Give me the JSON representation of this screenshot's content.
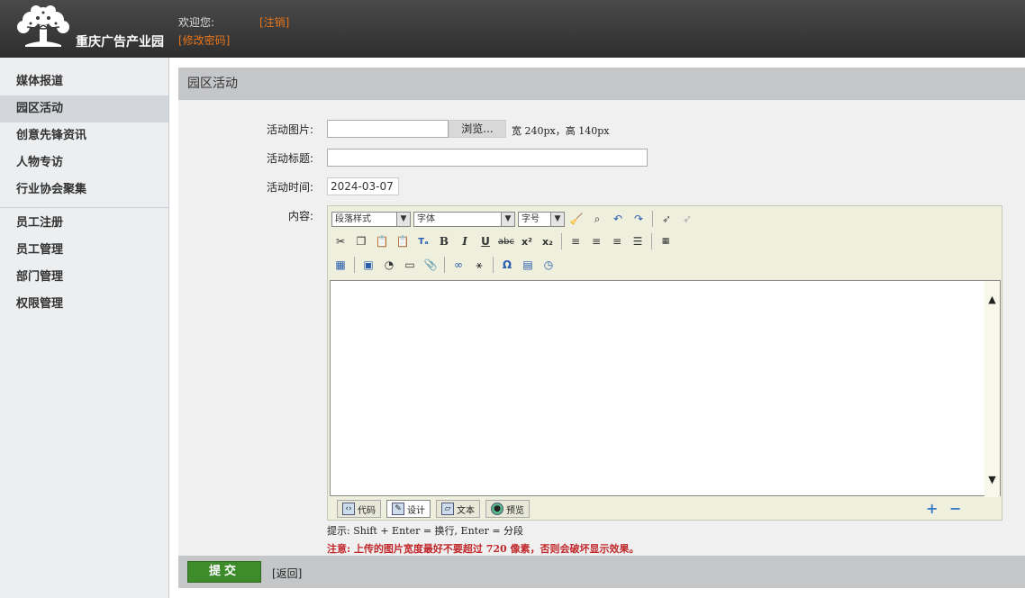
{
  "header": {
    "logo_text": "重庆广告产业园",
    "welcome": "欢迎您:",
    "logout": "[注销]",
    "change_password": "[修改密码]"
  },
  "sidebar": {
    "group1": [
      {
        "label": "媒体报道",
        "active": false
      },
      {
        "label": "园区活动",
        "active": true
      },
      {
        "label": "创意先锋资讯",
        "active": false
      },
      {
        "label": "人物专访",
        "active": false
      },
      {
        "label": "行业协会聚集",
        "active": false
      }
    ],
    "group2": [
      {
        "label": "员工注册"
      },
      {
        "label": "员工管理"
      },
      {
        "label": "部门管理"
      },
      {
        "label": "权限管理"
      }
    ]
  },
  "main": {
    "title": "园区活动",
    "image_label": "活动图片:",
    "browse_label": "浏览...",
    "size_hint": "宽 240px，高 140px",
    "title_label": "活动标题:",
    "title_value": "",
    "time_label": "活动时间:",
    "time_value": "2024-03-07",
    "content_label": "内容:"
  },
  "editor": {
    "paragraph_select": "段落样式",
    "font_select": "字体",
    "size_select": "字号",
    "modes": [
      "代码",
      "设计",
      "文本",
      "预览"
    ],
    "active_mode": "设计"
  },
  "hint": "提示: Shift + Enter = 换行, Enter = 分段",
  "warning": "注意: 上传的图片宽度最好不要超过 720 像素，否则会破坏显示效果。",
  "footer": {
    "submit_label": "提交",
    "back_label": "[返回]"
  }
}
